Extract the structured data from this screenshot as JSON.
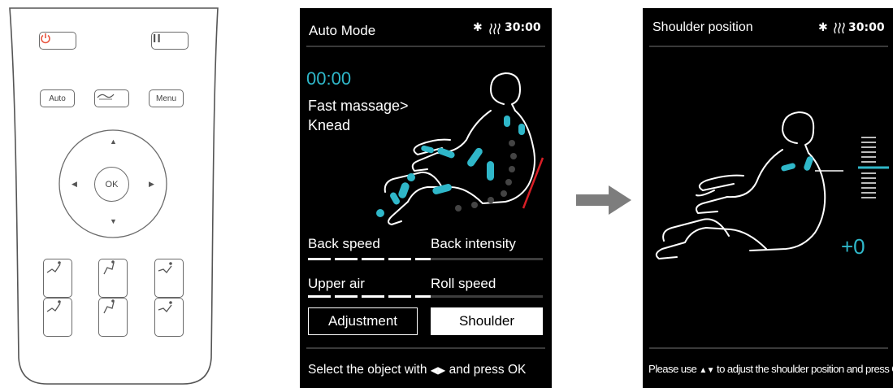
{
  "remote": {
    "auto_label": "Auto",
    "menu_label": "Menu",
    "ok_label": "OK",
    "power_color": "#e8553f"
  },
  "screen1": {
    "title": "Auto Mode",
    "time": "30:00",
    "timer": "00:00",
    "program_line1": "Fast massage>",
    "program_line2": "Knead",
    "options": {
      "back_speed": "Back speed",
      "back_intensity": "Back intensity",
      "upper_air": "Upper air",
      "roll_speed": "Roll speed",
      "adjustment": "Adjustment",
      "shoulder": "Shoulder"
    },
    "footer_prefix": "Select the object with",
    "footer_suffix": "and press OK",
    "accent_color": "#2fb7c9",
    "track_color": "#d81f26"
  },
  "screen2": {
    "title": "Shoulder position",
    "time": "30:00",
    "value": "+0",
    "footer_prefix": "Please use",
    "footer_suffix": "to adjust the shoulder position and press OK"
  }
}
